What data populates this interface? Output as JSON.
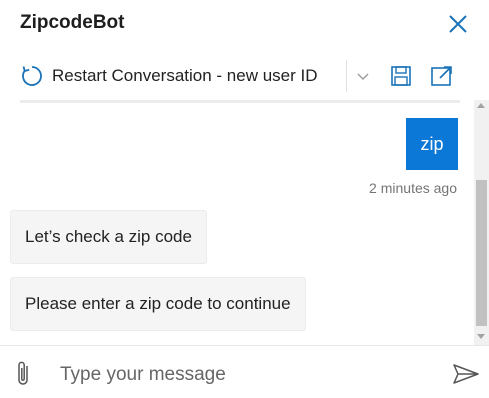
{
  "header": {
    "title": "ZipcodeBot",
    "close_icon": "close-icon"
  },
  "toolbar": {
    "restart_label": "Restart Conversation - new user ID",
    "restart_icon": "restart-icon",
    "dropdown_icon": "chevron-down-icon",
    "save_icon": "save-icon",
    "popout_icon": "popout-icon"
  },
  "transcript": {
    "messages": [
      {
        "from": "user",
        "text": "zip",
        "timestamp": "2 minutes ago"
      },
      {
        "from": "bot",
        "text": "Let’s check a zip code"
      },
      {
        "from": "bot",
        "text": "Please enter a zip code to continue"
      }
    ]
  },
  "compose": {
    "placeholder": "Type your message",
    "attach_icon": "paperclip-icon",
    "send_icon": "send-icon"
  },
  "colors": {
    "accent": "#0b78d7",
    "bot_bubble": "#f5f5f5",
    "icon": "#1a73b8"
  }
}
